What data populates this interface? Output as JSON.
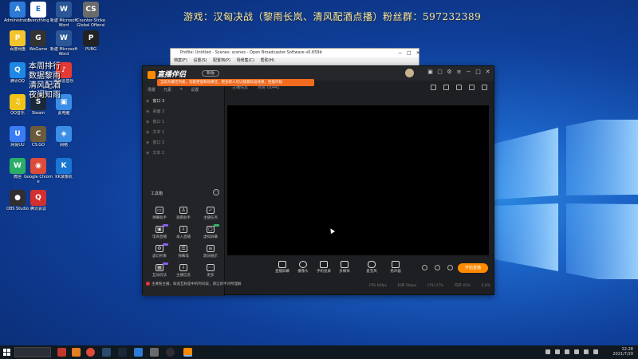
{
  "overlay": {
    "stream_title": "游戏：汉匈决战（黎雨长岚、清风配酒点播）粉丝群：597232389",
    "vertical_text": [
      "本周排行",
      "数据黎雨",
      "清风配酒",
      "夜阑知雨"
    ]
  },
  "desktop_icons": [
    {
      "label": "Administrator",
      "color": "#2d7bd6",
      "glyph": "A"
    },
    {
      "label": "Everything",
      "color": "#ffffff",
      "glyph": "E"
    },
    {
      "label": "新建 Microsoft Word",
      "color": "#2b5797",
      "glyph": "W"
    },
    {
      "label": "Counter-Strike Global Offensive",
      "color": "#6b6b6b",
      "glyph": "CS"
    },
    {
      "label": "百度网盘",
      "color": "#f3c42b",
      "glyph": "P"
    },
    {
      "label": "WeGame",
      "color": "#333333",
      "glyph": "G"
    },
    {
      "label": "新建 Microsoft Word",
      "color": "#2b5797",
      "glyph": "W"
    },
    {
      "label": "PUBG",
      "color": "#222222",
      "glyph": "P"
    },
    {
      "label": "腾讯QQ",
      "color": "#1e88e5",
      "glyph": "Q"
    },
    {
      "label": "网易云音乐",
      "color": "#e53935",
      "glyph": "♪"
    },
    {
      "label": "QQ音乐",
      "color": "#f0c419",
      "glyph": "♫"
    },
    {
      "label": "Steam",
      "color": "#1b2838",
      "glyph": "S"
    },
    {
      "label": "此电脑",
      "color": "#3a8ee6",
      "glyph": "▣"
    },
    {
      "label": "网易UU",
      "color": "#3b7cf4",
      "glyph": "U"
    },
    {
      "label": "CS:GO",
      "color": "#6b5b3a",
      "glyph": "C"
    },
    {
      "label": "网络",
      "color": "#3a8ee6",
      "glyph": "◈"
    },
    {
      "label": "微信",
      "color": "#2aae67",
      "glyph": "W"
    },
    {
      "label": "Google Chrome",
      "color": "#dd4b39",
      "glyph": "◉"
    },
    {
      "label": "KK录像机",
      "color": "#1976d2",
      "glyph": "K"
    },
    {
      "label": "OBS Studio",
      "color": "#302e31",
      "glyph": "●"
    },
    {
      "label": "腾讯会议",
      "color": "#d32f2f",
      "glyph": "Q"
    }
  ],
  "obs_window": {
    "title": "Profile: Untitled - Scenes: scenes - Open Broadcaster Software v0.659b",
    "menu": [
      "档案(F)",
      "设置(S)",
      "配置档(P)",
      "场景集(C)",
      "帮助(H)"
    ]
  },
  "app": {
    "name": "直播伴侣",
    "version": "新版",
    "warning": "当前为最佳内核，功能更强和效果佳，更多新人可以随意标准效果，性能内核",
    "tabs": [
      "场景",
      "元素",
      "+",
      "设置"
    ],
    "scenes": [
      "窗口 3",
      "桌面 2",
      "窗口 1",
      "文本 1",
      "窗口 2",
      "文本 2"
    ],
    "top_label_a": "主播信息",
    "top_label_b": "点赞 01441",
    "tools_header": "工具箱",
    "tools": [
      {
        "label": "弹幕助手",
        "glyph": "▭",
        "badge": ""
      },
      {
        "label": "观看助手",
        "glyph": "♙",
        "badge": ""
      },
      {
        "label": "主播任务",
        "glyph": "✓",
        "badge": ""
      },
      {
        "label": "电商直播",
        "glyph": "▣",
        "badge": "new"
      },
      {
        "label": "录入直播",
        "glyph": "⇩",
        "badge": ""
      },
      {
        "label": "虚拟屏幕",
        "glyph": "▢",
        "badge": "new-green"
      },
      {
        "label": "虚幻形象",
        "glyph": "⚙",
        "badge": "new"
      },
      {
        "label": "弹幕墙",
        "glyph": "☰",
        "badge": ""
      },
      {
        "label": "歌词展示",
        "glyph": "≡",
        "badge": ""
      },
      {
        "label": "互动玩法",
        "glyph": "▦",
        "badge": "new"
      },
      {
        "label": "主播信息",
        "glyph": "⇩",
        "badge": ""
      },
      {
        "label": "更多",
        "glyph": "⋯",
        "badge": ""
      }
    ],
    "controls": [
      {
        "label": "直播屏幕"
      },
      {
        "label": "摄像头"
      },
      {
        "label": "手机投屏"
      },
      {
        "label": "多媒体"
      },
      {
        "label": "麦克风"
      },
      {
        "label": "扬声器"
      }
    ],
    "go_live": "开始直播",
    "notice": "主要粉主播，知道互粉是中的时间段，请让新手对所理解",
    "status": [
      "FPS 60fps",
      "码率 0kbps",
      "CPU 27%",
      "内存 45%",
      "0.0%"
    ]
  },
  "taskbar": {
    "time": "22:28",
    "date": "2021/7/20",
    "search_placeholder": ""
  },
  "colors": {
    "accent": "#ff8a00",
    "warning": "#f26b1f",
    "window_bg": "#1e1f22"
  }
}
